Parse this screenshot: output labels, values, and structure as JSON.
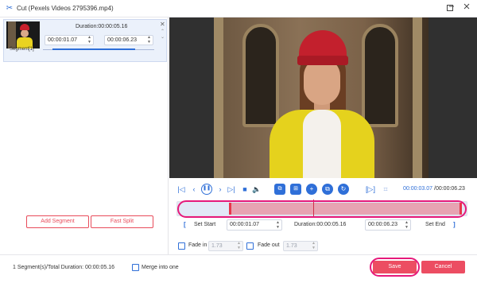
{
  "window": {
    "title": "Cut (Pexels Videos 2795396.mp4)",
    "minimize_icon": "minimize-icon",
    "maximize_icon": "maximize-icon",
    "close_icon": "close-icon"
  },
  "segment_card": {
    "duration": "Duration:00:00:05.16",
    "start": "00:00:01.07",
    "end": "00:00:06.23",
    "segment_label": "Segment[1]"
  },
  "left_buttons": {
    "add_segment": "Add Segment",
    "fast_split": "Fast Split"
  },
  "playback": {
    "current_time": "00:00:03.07",
    "total_time": "/00:00:06.23",
    "accent": "#2f6fd8"
  },
  "timeline": {
    "selection_start_fraction": 0.18,
    "selection_end_fraction": 0.98,
    "playhead_fraction": 0.47,
    "selection_color": "#e7a3b2"
  },
  "trim": {
    "set_start": "Set Start",
    "start_value": "00:00:01.07",
    "duration": "Duration:00:00:05.16",
    "end_value": "00:00:06.23",
    "set_end": "Set End"
  },
  "fade": {
    "fade_in_label": "Fade in",
    "fade_in_value": "1.73",
    "fade_out_label": "Fade out",
    "fade_out_value": "1.73"
  },
  "footer": {
    "summary": "1 Segment(s)/Total Duration: 00:00:05.16",
    "merge_label": "Merge into one",
    "save": "Save",
    "cancel": "Cancel",
    "button_color": "#ec4d62",
    "highlight_color": "#e6197a"
  }
}
